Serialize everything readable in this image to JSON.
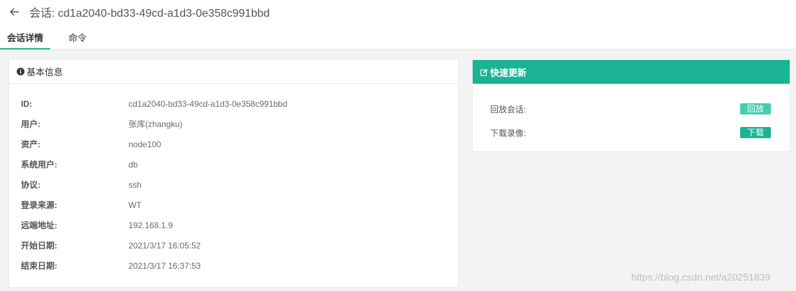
{
  "header": {
    "title": "会话: cd1a2040-bd33-49cd-a1d3-0e358c991bbd",
    "tabs": [
      {
        "label": "会话详情",
        "active": true
      },
      {
        "label": "命令",
        "active": false
      }
    ]
  },
  "basic_info": {
    "heading": "基本信息",
    "rows": [
      {
        "key": "ID:",
        "value": "cd1a2040-bd33-49cd-a1d3-0e358c991bbd"
      },
      {
        "key": "用户:",
        "value": "张库(zhangku)"
      },
      {
        "key": "资产:",
        "value": "node100"
      },
      {
        "key": "系统用户:",
        "value": "db"
      },
      {
        "key": "协议:",
        "value": "ssh"
      },
      {
        "key": "登录来源:",
        "value": "WT"
      },
      {
        "key": "远端地址:",
        "value": "192.168.1.9"
      },
      {
        "key": "开始日期:",
        "value": "2021/3/17 16:05:52"
      },
      {
        "key": "结束日期:",
        "value": "2021/3/17 16:37:53"
      }
    ]
  },
  "quick_update": {
    "heading": "快速更新",
    "replay_label": "回放会话:",
    "replay_button": "回放",
    "download_label": "下载录像:",
    "download_button": "下载"
  },
  "watermark": "https://blog.csdn.net/a20251839",
  "colors": {
    "accent": "#1ab394",
    "header_bg": "#ffffff",
    "page_bg": "#f3f3f4"
  }
}
